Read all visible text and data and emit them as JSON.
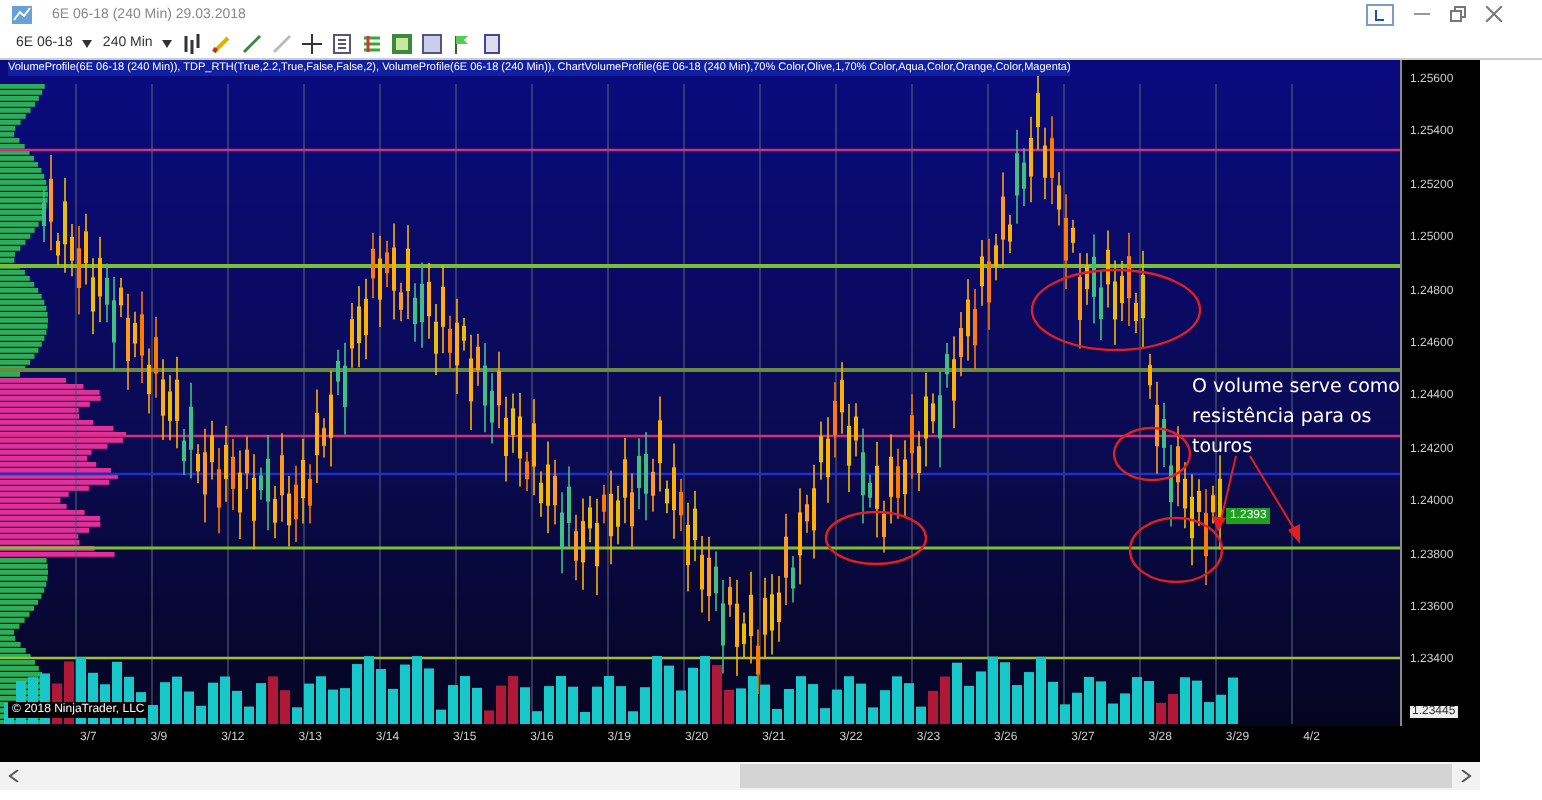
{
  "window": {
    "title": "6E 06-18 (240 Min)  29.03.2018"
  },
  "toolbar": {
    "instrument": "6E 06-18",
    "interval": "240 Min"
  },
  "chart": {
    "indicator_label": "VolumeProfile(6E 06-18 (240 Min)), TDP_RTH(True,2.2,True,False,False,2), VolumeProfile(6E 06-18 (240 Min)), ChartVolumeProfile(6E 06-18 (240 Min),70% Color,Olive,1,70% Color,Aqua,Color,Orange,Color,Magenta)",
    "annotation": "O volume serve como resistência para os touros",
    "price_tag": "1.2393",
    "price_axis": [
      "1.25600",
      "1.25400",
      "1.25200",
      "1.25000",
      "1.24800",
      "1.24600",
      "1.24400",
      "1.24200",
      "1.24000",
      "1.23800",
      "1.23600",
      "1.23400"
    ],
    "last_label": "1.23445",
    "date_axis": [
      "3/7",
      "3/9",
      "3/12",
      "3/13",
      "3/14",
      "3/15",
      "3/16",
      "3/19",
      "3/20",
      "3/21",
      "3/22",
      "3/23",
      "3/26",
      "3/27",
      "3/28",
      "3/29",
      "4/2"
    ],
    "copyright": "© 2018 NinjaTrader, LLC"
  }
}
